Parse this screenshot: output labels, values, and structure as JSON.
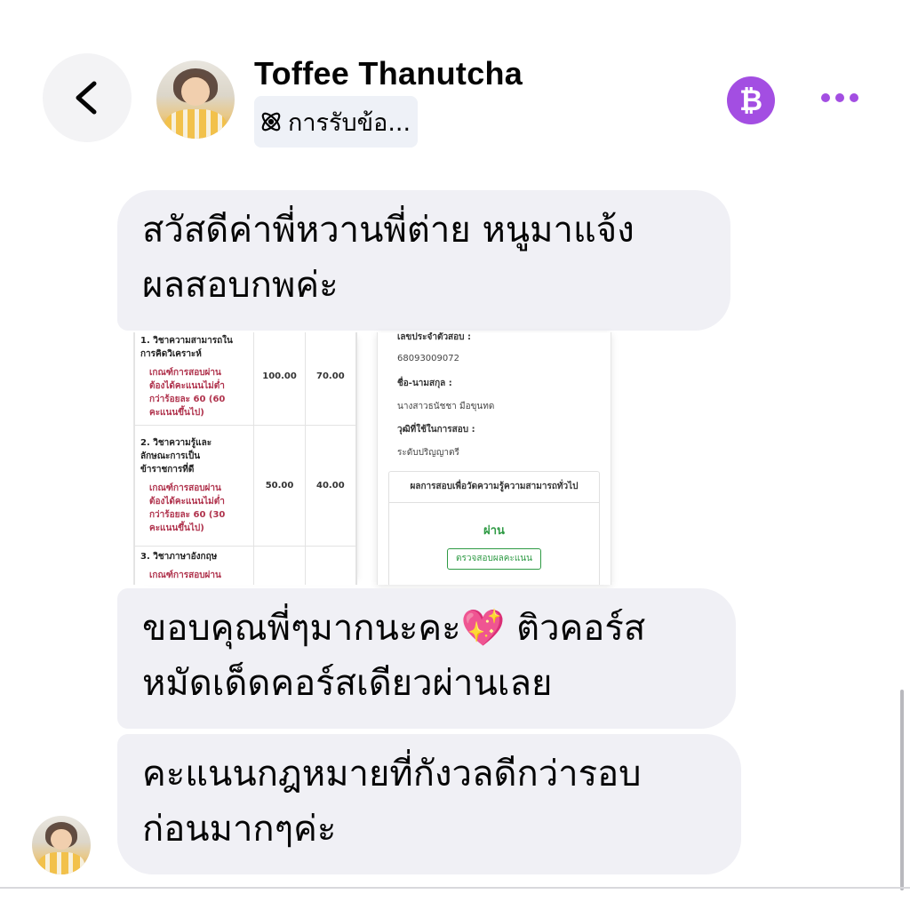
{
  "header": {
    "contact_name": "Toffee Thanutcha",
    "status_text": "การรับข้อ...",
    "back_icon": "chevron-left-icon",
    "status_icon": "atom-icon",
    "bitcoin_icon": "bitcoin-icon",
    "more_icon": "more-dots-icon",
    "accent_color": "#a34ee2"
  },
  "messages": [
    {
      "text": "สวัสดีค่าพี่หวานพี่ต่าย หนูมาแจ้ง\nผลสอบกพค่ะ"
    },
    {
      "text": "ขอบคุณพี่ๆมากนะคะ💖 ติวคอร์ส\nหมัดเด็ดคอร์สเดียวผ่านเลย"
    },
    {
      "text": "คะแนนกฎหมายที่กังวลดีกว่ารอบ\nก่อนมากๆค่ะ"
    }
  ],
  "exam_screenshot": {
    "subjects": [
      {
        "name": "1. วิชาความสามารถใน\nการคิดวิเคราะห์",
        "criteria": "เกณฑ์การสอบผ่าน\nต้องได้คะแนนไม่ต่ำ\nกว่าร้อยละ 60 (60\nคะแนนขึ้นไป)",
        "full_score": "100.00",
        "score": "70.00"
      },
      {
        "name": "2. วิชาความรู้และ\nลักษณะการเป็น\nข้าราชการที่ดี",
        "criteria": "เกณฑ์การสอบผ่าน\nต้องได้คะแนนไม่ต่ำ\nกว่าร้อยละ 60 (30\nคะแนนขึ้นไป)",
        "full_score": "50.00",
        "score": "40.00"
      },
      {
        "name": "3. วิชาภาษาอังกฤษ",
        "criteria": "เกณฑ์การสอบผ่าน",
        "full_score": "",
        "score": ""
      }
    ],
    "id_label": "เลขประจำตัวสอบ :",
    "id_value": "68093009072",
    "name_label": "ชื่อ-นามสกุล :",
    "name_value": "นางสาวธนัชชา มือขุนทด",
    "degree_label": "วุฒิที่ใช้ในการสอบ :",
    "degree_value": "ระดับปริญญาตรี",
    "result_title": "ผลการสอบเพื่อวัดความรู้ความสามารถทั่วไป",
    "result_status": "ผ่าน",
    "check_button": "ตรวจสอบผลคะแนน"
  }
}
